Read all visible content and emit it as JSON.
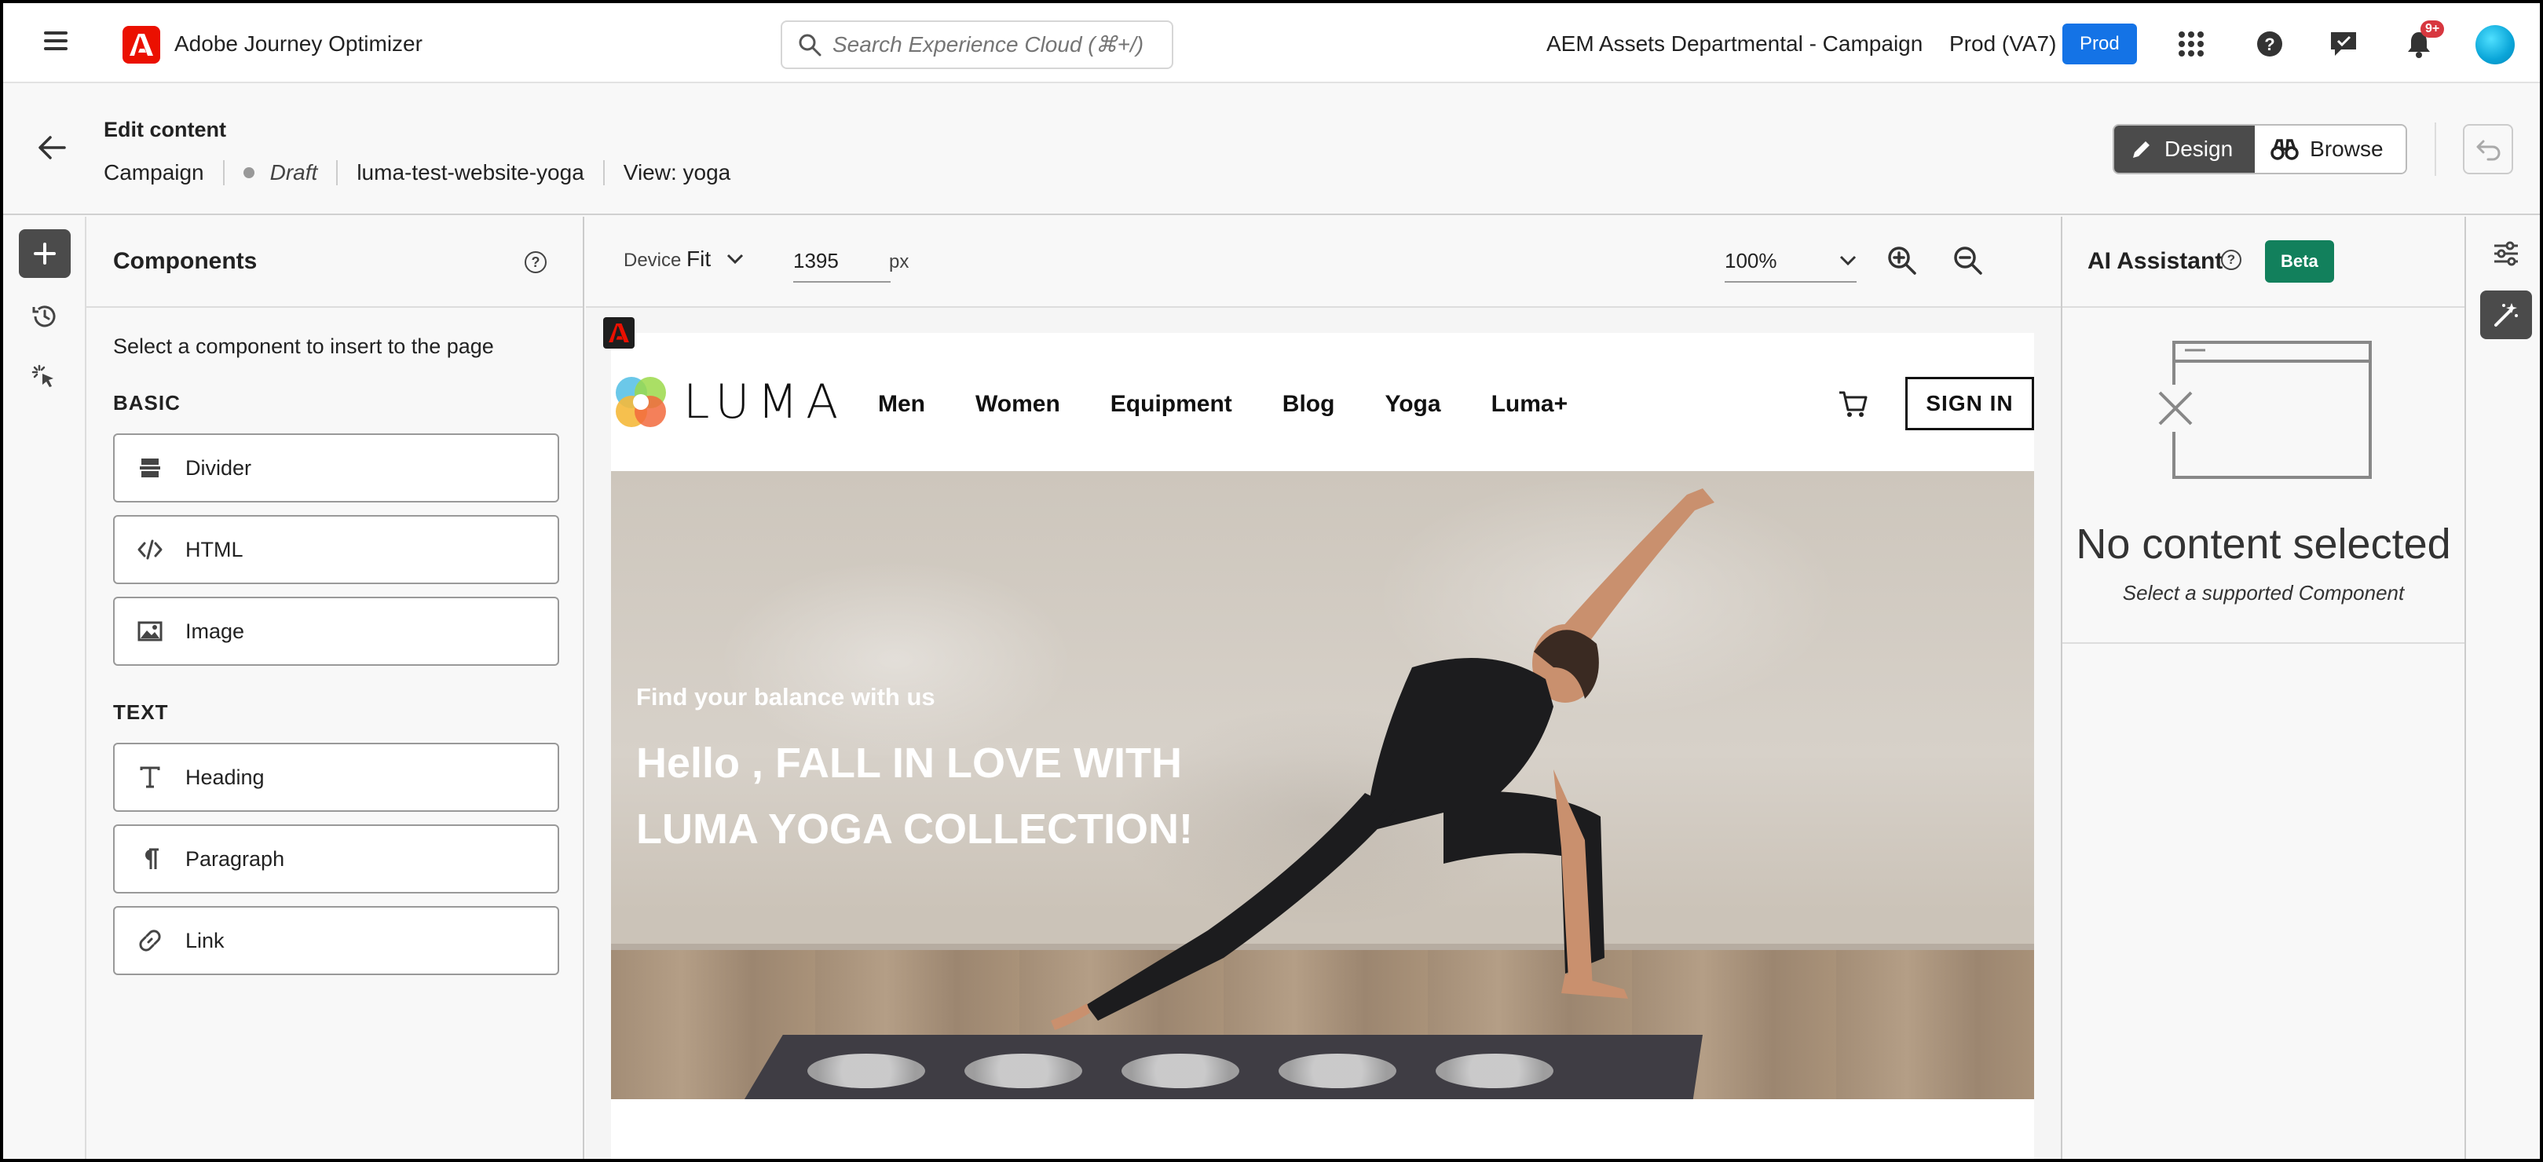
{
  "topbar": {
    "app_title": "Adobe Journey Optimizer",
    "search_placeholder": "Search Experience Cloud (⌘+/)",
    "org_name": "AEM Assets Departmental - Campaign",
    "env_label": "Prod (VA7)",
    "env_badge": "Prod",
    "notification_count": "9+",
    "icons": [
      "menu-icon",
      "adobe-logo",
      "search-icon",
      "apps-grid-icon",
      "help-icon",
      "feedback-icon",
      "bell-icon",
      "avatar"
    ]
  },
  "edit_header": {
    "title": "Edit content",
    "breadcrumb": {
      "type": "Campaign",
      "status": "Draft",
      "name": "luma-test-website-yoga",
      "view": "View: yoga"
    },
    "design_label": "Design",
    "browse_label": "Browse"
  },
  "components": {
    "title": "Components",
    "intro": "Select a component to insert to the page",
    "sections": [
      {
        "label": "BASIC",
        "items": [
          {
            "label": "Divider",
            "icon": "divider-icon"
          },
          {
            "label": "HTML",
            "icon": "code-icon"
          },
          {
            "label": "Image",
            "icon": "image-icon"
          }
        ]
      },
      {
        "label": "TEXT",
        "items": [
          {
            "label": "Heading",
            "icon": "heading-icon"
          },
          {
            "label": "Paragraph",
            "icon": "paragraph-icon"
          },
          {
            "label": "Link",
            "icon": "link-icon"
          }
        ]
      }
    ]
  },
  "canvas_toolbar": {
    "device_label": "Device",
    "device_value": "Fit",
    "width_value": "1395",
    "width_unit": "px",
    "zoom_value": "100%"
  },
  "preview": {
    "logo_text": "LUMA",
    "nav": [
      "Men",
      "Women",
      "Equipment",
      "Blog",
      "Yoga",
      "Luma+"
    ],
    "signin_label": "SIGN IN",
    "hero_subtitle": "Find your balance with us",
    "hero_title": "Hello , FALL IN LOVE WITH LUMA YOGA COLLECTION!"
  },
  "ai_assistant": {
    "title": "AI Assistant",
    "badge": "Beta",
    "empty_title": "No content selected",
    "empty_subtitle": "Select a supported Component"
  },
  "colors": {
    "accent_blue": "#1473e6",
    "adobe_red": "#eb1000",
    "beta_green": "#12805c",
    "active_dark": "#4b4b4b",
    "notification_red": "#d7373f"
  }
}
